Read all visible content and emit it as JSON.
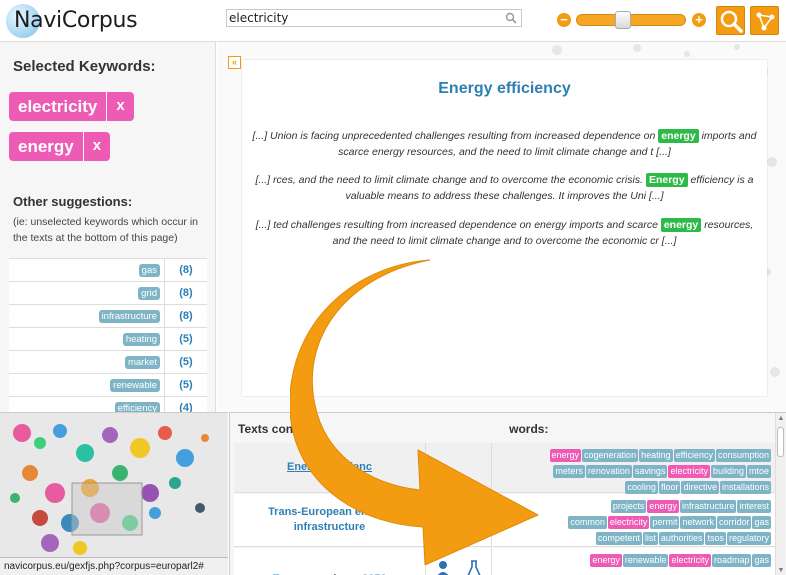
{
  "header": {
    "logo_text": "NaviCorpus",
    "search_value": "electricity",
    "zoom_level": 0.42
  },
  "left": {
    "selected_title": "Selected Keywords:",
    "selected_keywords": [
      {
        "label": "electricity",
        "remove": "x"
      },
      {
        "label": "energy",
        "remove": "x"
      }
    ],
    "suggestions_title": "Other suggestions:",
    "suggestions_desc": "(ie: unselected keywords which occur in the texts at the bottom of this page)",
    "suggestions": [
      {
        "keyword": "gas",
        "count": "(8)"
      },
      {
        "keyword": "grid",
        "count": "(8)"
      },
      {
        "keyword": "infrastructure",
        "count": "(8)"
      },
      {
        "keyword": "heating",
        "count": "(5)"
      },
      {
        "keyword": "market",
        "count": "(5)"
      },
      {
        "keyword": "renewable",
        "count": "(5)"
      },
      {
        "keyword": "efficiency",
        "count": "(4)"
      }
    ]
  },
  "content": {
    "title": "Energy efficiency",
    "snippets": [
      {
        "before": "[...] Union is facing unprecedented challenges resulting from increased dependence on ",
        "hl": "energy",
        "after": " imports and scarce energy resources, and the need to limit climate change and t [...]"
      },
      {
        "before": "[...] rces, and the need to limit climate change and to overcome the economic crisis. ",
        "hl": "Energy",
        "after": " efficiency is a valuable means to address these challenges. It improves the Uni [...]"
      },
      {
        "before": "[...] ted challenges resulting from increased dependence on energy imports and scarce ",
        "hl": "energy",
        "after": " resources, and the need to limit climate change and to overcome the economic cr [...]"
      }
    ],
    "collapse_glyph": "«"
  },
  "status_url": "navicorpus.eu/gexfjs.php?corpus=europarl2#",
  "texts": {
    "title": "Texts cont",
    "title_end": "words:",
    "rows": [
      {
        "name": "Energy efficienc",
        "tags": [
          {
            "t": "energy",
            "pink": true
          },
          {
            "t": "cogeneration",
            "pink": false
          },
          {
            "t": "heating",
            "pink": false
          },
          {
            "t": "efficiency",
            "pink": false
          },
          {
            "t": "consumption",
            "pink": false
          },
          {
            "t": "meters",
            "pink": false
          },
          {
            "t": "renovation",
            "pink": false
          },
          {
            "t": "savings",
            "pink": false
          },
          {
            "t": "electricity",
            "pink": true
          },
          {
            "t": "building",
            "pink": false
          },
          {
            "t": "mtoe",
            "pink": false
          },
          {
            "t": "cooling",
            "pink": false
          },
          {
            "t": "floor",
            "pink": false
          },
          {
            "t": "directive",
            "pink": false
          },
          {
            "t": "installations",
            "pink": false
          }
        ]
      },
      {
        "name": "Trans-European energy infrastructure",
        "tags": [
          {
            "t": "projects",
            "pink": false
          },
          {
            "t": "energy",
            "pink": true
          },
          {
            "t": "infrastructure",
            "pink": false
          },
          {
            "t": "interest",
            "pink": false
          },
          {
            "t": "common",
            "pink": false
          },
          {
            "t": "electricity",
            "pink": true
          },
          {
            "t": "permit",
            "pink": false
          },
          {
            "t": "network",
            "pink": false
          },
          {
            "t": "corridor",
            "pink": false
          },
          {
            "t": "gas",
            "pink": false
          },
          {
            "t": "competent",
            "pink": false
          },
          {
            "t": "list",
            "pink": false
          },
          {
            "t": "authorities",
            "pink": false
          },
          {
            "t": "tsos",
            "pink": false
          },
          {
            "t": "regulatory",
            "pink": false
          }
        ]
      },
      {
        "name": "Energy roadmap 2050",
        "tags": [
          {
            "t": "energy",
            "pink": true
          },
          {
            "t": "renewable",
            "pink": false
          },
          {
            "t": "electricity",
            "pink": true
          },
          {
            "t": "roadmap",
            "pink": false
          },
          {
            "t": "gas",
            "pink": false
          }
        ]
      }
    ]
  },
  "colors": {
    "accent_orange": "#f39c12",
    "keyword_pink": "#ee5bb5",
    "highlight_green": "#2eba48",
    "link_blue": "#2f7fb5",
    "tag_blue": "#7fb3c6"
  }
}
